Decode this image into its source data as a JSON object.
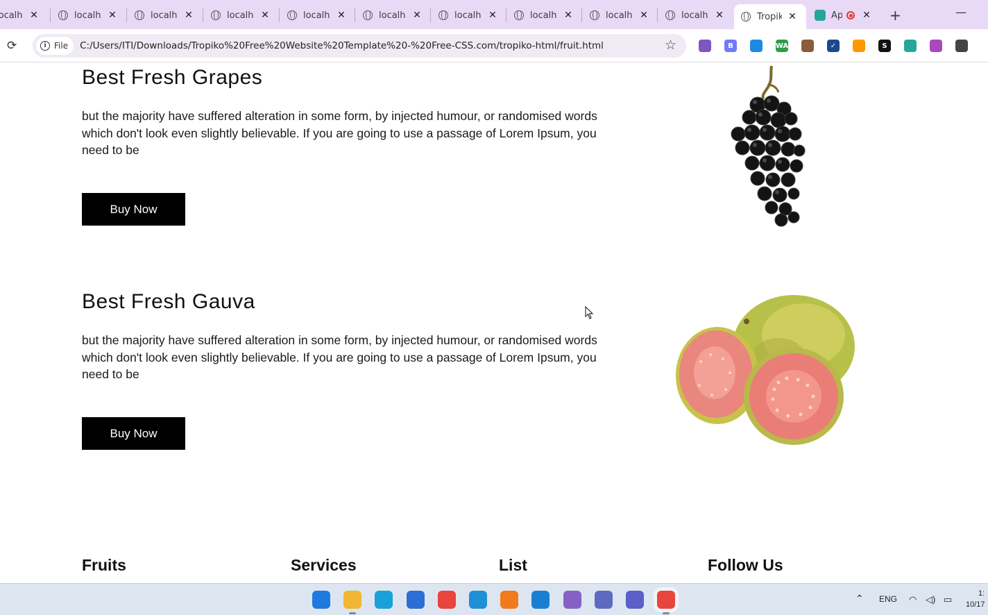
{
  "browser": {
    "tabs": [
      {
        "label": "localhc"
      },
      {
        "label": "localhc"
      },
      {
        "label": "localhc"
      },
      {
        "label": "localhc"
      },
      {
        "label": "localhc"
      },
      {
        "label": "localhc"
      },
      {
        "label": "localhc"
      },
      {
        "label": "localhc"
      },
      {
        "label": "localhc"
      },
      {
        "label": "localhc"
      }
    ],
    "active_tab": {
      "label": "Tropik"
    },
    "app_tab": {
      "label": "Ap"
    },
    "site_info_label": "File",
    "url": "C:/Users/ITI/Downloads/Tropiko%20Free%20Website%20Template%20-%20Free-CSS.com/tropiko-html/fruit.html",
    "extensions": [
      {
        "icon": "puzzle-gear-icon",
        "color": "#7e57c2",
        "text": ""
      },
      {
        "icon": "b-extension-icon",
        "color": "#6f7bf7",
        "text": "B"
      },
      {
        "icon": "feather-icon",
        "color": "#1e88e5",
        "text": ""
      },
      {
        "icon": "wa-icon",
        "color": "#2e9c4a",
        "text": "WA"
      },
      {
        "icon": "cookie-icon",
        "color": "#8d5a3b",
        "text": ""
      },
      {
        "icon": "check-circle-icon",
        "color": "#1a4a8a",
        "text": "✓"
      },
      {
        "icon": "ring-icon",
        "color": "#ff9800",
        "text": ""
      },
      {
        "icon": "s-icon",
        "color": "#111111",
        "text": "S"
      },
      {
        "icon": "chat-icon",
        "color": "#26a69a",
        "text": ""
      },
      {
        "icon": "brain-icon",
        "color": "#ab47bc",
        "text": ""
      },
      {
        "icon": "extensions-puzzle-icon",
        "color": "#444444",
        "text": ""
      }
    ]
  },
  "products": [
    {
      "title": "Best Fresh Grapes",
      "description": "but the majority have suffered alteration in some form, by injected humour, or randomised words which don't look even slightly believable. If you are going to use a passage of Lorem Ipsum, you need to be",
      "button": "Buy Now",
      "image": "grapes-image"
    },
    {
      "title": "Best Fresh Gauva",
      "description": "but the majority have suffered alteration in some form, by injected humour, or randomised words which don't look even slightly believable. If you are going to use a passage of Lorem Ipsum, you need to be",
      "button": "Buy Now",
      "image": "guava-image"
    }
  ],
  "footer": {
    "columns": [
      "Fruits",
      "Services",
      "List",
      "Follow Us"
    ]
  },
  "taskbar": {
    "apps": [
      {
        "icon": "windows-start-icon",
        "color": "#1f7ae0"
      },
      {
        "icon": "file-explorer-icon",
        "color": "#f2b632"
      },
      {
        "icon": "edge-icon",
        "color": "#1aa0d8"
      },
      {
        "icon": "store-icon",
        "color": "#2b6fd6"
      },
      {
        "icon": "chrome-icon",
        "color": "#e8453c"
      },
      {
        "icon": "anydesk-icon",
        "color": "#1f8fd6"
      },
      {
        "icon": "xampp-icon",
        "color": "#f07b1d"
      },
      {
        "icon": "vscode-icon",
        "color": "#1b7fd1"
      },
      {
        "icon": "visual-studio-icon",
        "color": "#8661c5"
      },
      {
        "icon": "iptv-icon",
        "color": "#5c6bc0"
      },
      {
        "icon": "teams-icon",
        "color": "#5b5fc7"
      },
      {
        "icon": "chrome-active-icon",
        "color": "#e8453c"
      }
    ],
    "language": "ENG",
    "time": "1:",
    "date": "10/17"
  }
}
